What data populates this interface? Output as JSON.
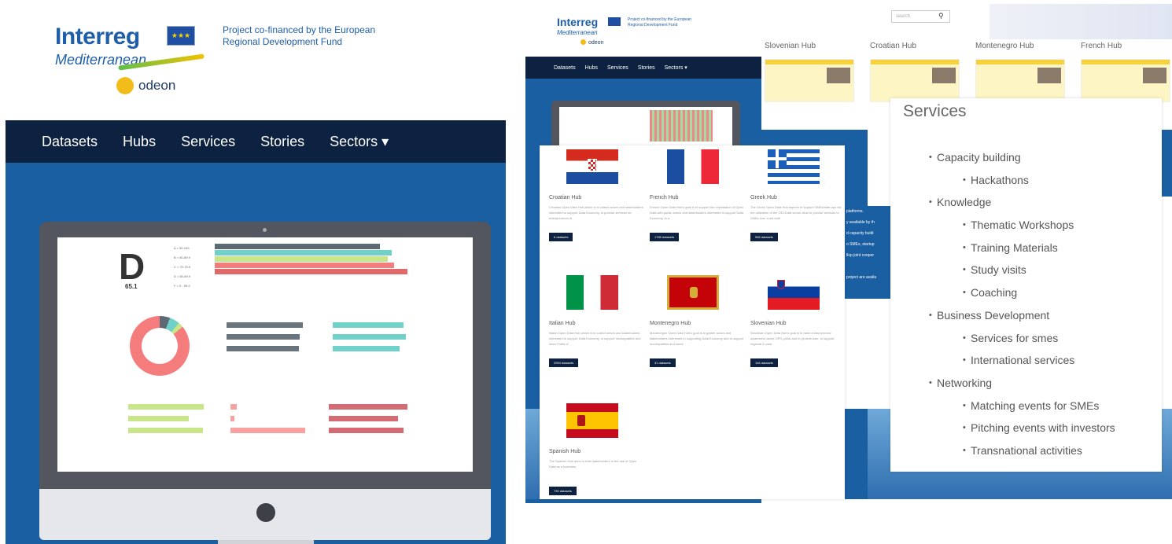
{
  "left": {
    "logo": {
      "interreg": "Interreg",
      "mediterranean": "Mediterranean",
      "odeon": "odeon"
    },
    "cofinanced": "Project co-financed by the European Regional Development Fund",
    "nav": [
      "Datasets",
      "Hubs",
      "Services",
      "Stories",
      "Sectors ▾"
    ],
    "dashboard": {
      "grade": "D",
      "grade_value": "65.1",
      "legend": [
        "A = 90-100",
        "B = 80-89.9",
        "C = 70-79.9",
        "D = 60-69.9",
        "F = 0 - 59.9"
      ]
    }
  },
  "right": {
    "logo": {
      "interreg": "Interreg",
      "mediterranean": "Mediterranean",
      "odeon": "odeon"
    },
    "cofinanced": "Project co-financed by the European Regional Development Fund",
    "search_placeholder": "search",
    "nav": [
      "Datasets",
      "Hubs",
      "Services",
      "Stories",
      "Sectors ▾"
    ],
    "hub_strip": [
      "Slovenian Hub",
      "Croatian Hub",
      "Montenegro Hub",
      "French Hub"
    ],
    "hubs": [
      {
        "name": "Croatian Hub",
        "button": "6 datasets"
      },
      {
        "name": "French Hub",
        "button": "1765 datasets"
      },
      {
        "name": "Greek Hub",
        "button": "966 datasets"
      },
      {
        "name": "Italian Hub",
        "button": "2994 datasets"
      },
      {
        "name": "Montenegro Hub",
        "button": "31 datasets"
      },
      {
        "name": "Slovenian Hub",
        "button": "146 datasets"
      },
      {
        "name": "Spanish Hub",
        "button": "790 datasets"
      }
    ],
    "services": {
      "title": "Services",
      "items": [
        {
          "label": "Capacity building",
          "level": 1
        },
        {
          "label": "Hackathons",
          "level": 2
        },
        {
          "label": "Knowledge",
          "level": 1
        },
        {
          "label": "Thematic Workshops",
          "level": 2
        },
        {
          "label": "Training Materials",
          "level": 2
        },
        {
          "label": "Study visits",
          "level": 2
        },
        {
          "label": "Coaching",
          "level": 2
        },
        {
          "label": "Business Development",
          "level": 1
        },
        {
          "label": "Services for smes",
          "level": 2
        },
        {
          "label": "International services",
          "level": 2
        },
        {
          "label": "Networking",
          "level": 1
        },
        {
          "label": "Matching events for SMEs",
          "level": 2
        },
        {
          "label": "Pitching events with investors",
          "level": 2
        },
        {
          "label": "Transnational activities",
          "level": 2
        }
      ]
    }
  }
}
